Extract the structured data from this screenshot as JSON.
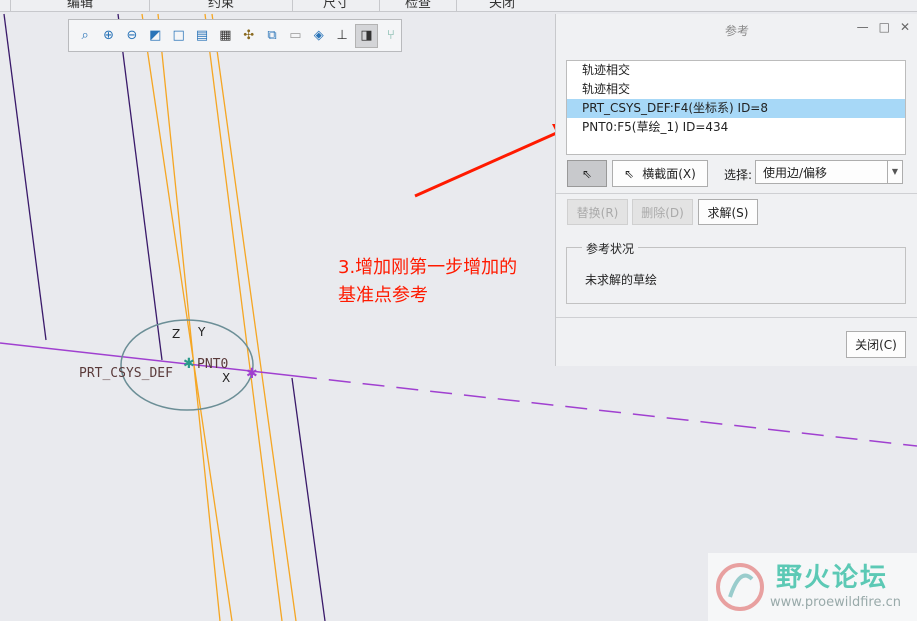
{
  "ribbon_tabs": [
    "编辑",
    "约束",
    "尺寸",
    "检查",
    "关闭"
  ],
  "toolbar": {
    "icons": [
      "zoom-window-icon",
      "zoom-in-icon",
      "zoom-out-icon",
      "repaint-icon",
      "display-style-icon",
      "saved-views-icon",
      "snapshot-icon",
      "datum-display-icon",
      "orient-sketch-icon",
      "shading-icon",
      "shading-edges-icon",
      "dimension-display-icon",
      "sketch-view-icon",
      "constraint-display-icon"
    ]
  },
  "canvas": {
    "csys_label": "PRT_CSYS_DEF",
    "pnt_label": "PNT0",
    "axis_z": "Z",
    "axis_y": "Y",
    "axis_x": "X"
  },
  "annotation": {
    "line1": "3.增加刚第一步增加的",
    "line2": "基准点参考",
    "color": "#ff1a00"
  },
  "dialog": {
    "title": "参考",
    "references": [
      {
        "label": "轨迹相交",
        "selected": false
      },
      {
        "label": "轨迹相交",
        "selected": false
      },
      {
        "label": "PRT_CSYS_DEF:F4(坐标系) ID=8",
        "selected": true
      },
      {
        "label": "PNT0:F5(草绘_1) ID=434",
        "selected": false
      }
    ],
    "xsec_button": "横截面(X)",
    "select_label": "选择:",
    "select_value": "使用边/偏移",
    "replace_button": "替换(R)",
    "delete_button": "删除(D)",
    "solve_button": "求解(S)",
    "status_group": "参考状况",
    "status_text": "未求解的草绘",
    "close_button": "关闭(C)"
  },
  "watermark": {
    "title": "野火论坛",
    "url": "www.proewildfire.cn"
  }
}
